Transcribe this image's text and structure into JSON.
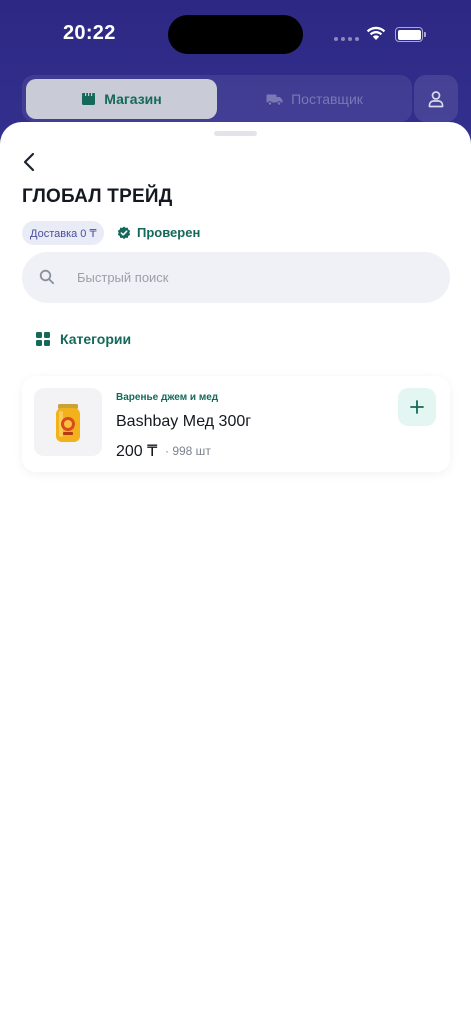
{
  "status_bar": {
    "time": "20:22"
  },
  "top_tabs": {
    "store_label": "Магазин",
    "supplier_label": "Поставщик"
  },
  "store": {
    "title": "ГЛОБАЛ ТРЕЙД",
    "delivery_badge": "Доставка 0 ₸",
    "verified_label": "Проверен"
  },
  "search": {
    "placeholder": "Быстрый поиск",
    "value": ""
  },
  "categories_label": "Категории",
  "products": [
    {
      "category": "Варенье джем и мед",
      "name": "Bashbay Мед 300г",
      "price": "200 ₸",
      "stock": "· 998 шт"
    }
  ],
  "colors": {
    "header_bg": "#2c2883",
    "accent": "#14695a",
    "badge_bg": "#e9ebf7"
  }
}
